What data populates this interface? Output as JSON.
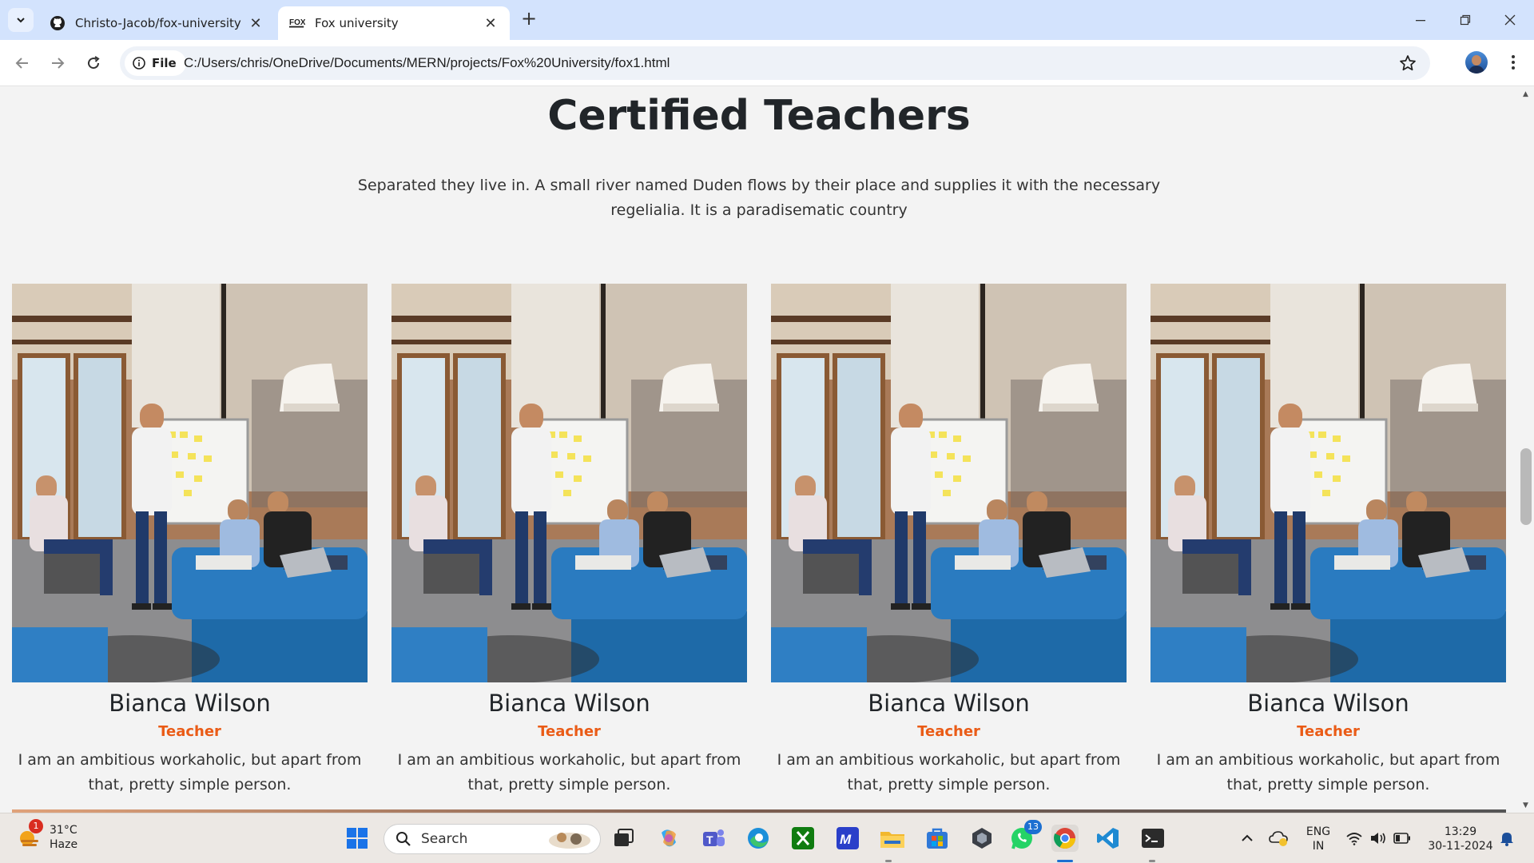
{
  "browser": {
    "tabs": [
      {
        "title": "Christo-Jacob/fox-university",
        "favicon": "github-icon",
        "active": false
      },
      {
        "title": "Fox university",
        "favicon": "fox-logo-icon",
        "active": true
      }
    ],
    "site_chip_label": "File",
    "url": "C:/Users/chris/OneDrive/Documents/MERN/projects/Fox%20University/fox1.html"
  },
  "page": {
    "heading": "Certified Teachers",
    "subtext": "Separated they live in. A small river named Duden flows by their place and supplies it with the necessary regelialia. It is a paradisematic country",
    "teachers": [
      {
        "name": "Bianca Wilson",
        "role": "Teacher",
        "bio": "I am an ambitious workaholic, but apart from that, pretty simple person."
      },
      {
        "name": "Bianca Wilson",
        "role": "Teacher",
        "bio": "I am an ambitious workaholic, but apart from that, pretty simple person."
      },
      {
        "name": "Bianca Wilson",
        "role": "Teacher",
        "bio": "I am an ambitious workaholic, but apart from that, pretty simple person."
      },
      {
        "name": "Bianca Wilson",
        "role": "Teacher",
        "bio": "I am an ambitious workaholic, but apart from that, pretty simple person."
      }
    ],
    "accent_color": "#ea5b16"
  },
  "taskbar": {
    "weather": {
      "temp": "31°C",
      "condition": "Haze",
      "alert_count": "1"
    },
    "search_placeholder": "Search",
    "whatsapp_badge": "13",
    "language": {
      "line1": "ENG",
      "line2": "IN"
    },
    "time": "13:29",
    "date": "30-11-2024"
  }
}
